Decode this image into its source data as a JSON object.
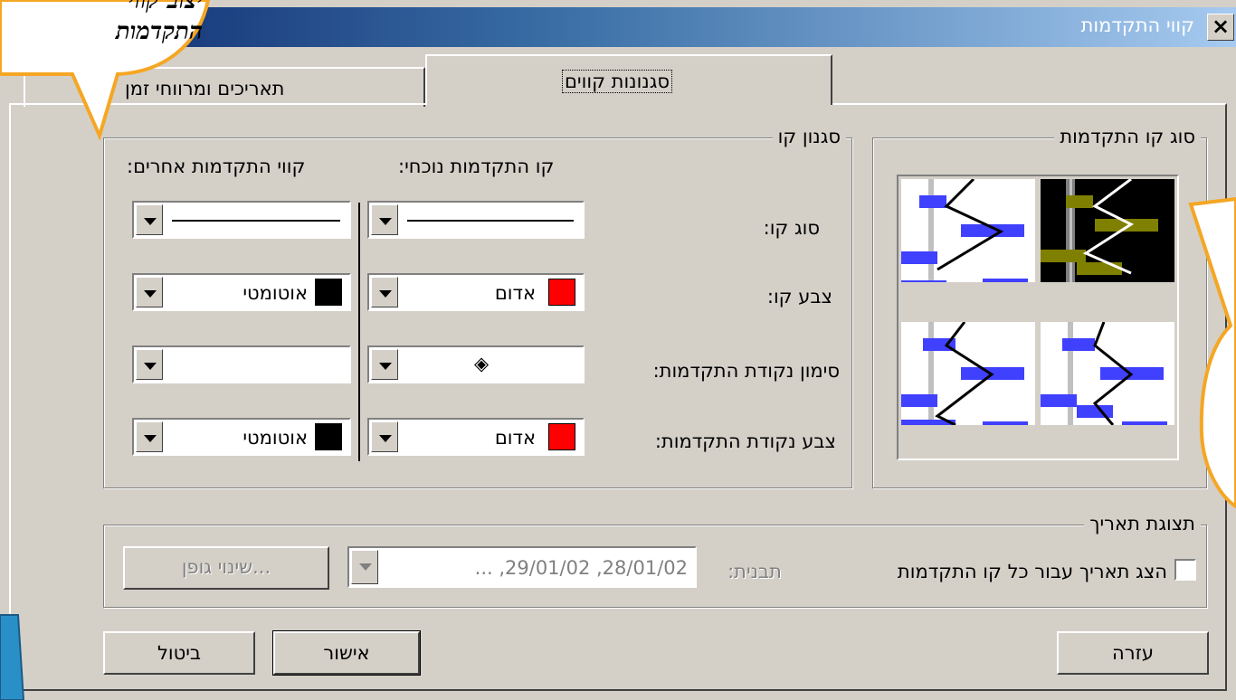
{
  "window": {
    "title": "קווי התקדמות"
  },
  "tabs": [
    {
      "label": "סגנונות קווים",
      "active": true
    },
    {
      "label": "תאריכים ומרווחי זמן",
      "active": false
    }
  ],
  "progress_type_group": {
    "title": "סוג קו התקדמות"
  },
  "line_style_group": {
    "title": "סגנון קו",
    "col_current": "קו התקדמות נוכחי:",
    "col_other": "קווי התקדמות אחרים:",
    "rows": {
      "line_type": "סוג קו:",
      "line_color": "צבע קו:",
      "point_marker": "סימון נקודת התקדמות:",
      "point_color": "צבע נקודת התקדמות:"
    },
    "current": {
      "line_color": {
        "text": "אדום",
        "swatch": "#ff0000"
      },
      "point_color": {
        "text": "אדום",
        "swatch": "#ff0000"
      },
      "point_marker_glyph": "◈"
    },
    "other": {
      "line_color": {
        "text": "אוטומטי",
        "swatch": "#000000"
      },
      "point_color": {
        "text": "אוטומטי",
        "swatch": "#000000"
      }
    }
  },
  "date_display_group": {
    "title": "תצוגת תאריך",
    "checkbox_label": "הצג תאריך עבור כל קו התקדמות",
    "checked": false,
    "format_label": "תבנית:",
    "format_value": "... ,29/01/02 ,28/01/02",
    "font_button": "שינוי גופן..."
  },
  "buttons": {
    "help": "עזרה",
    "ok": "אישור",
    "cancel": "ביטול"
  },
  "callout_text": [
    "יצוב קווי",
    "התקדמות"
  ],
  "colors": {
    "titlebar_start": "#0a246a",
    "titlebar_end": "#a6caf0",
    "face": "#d4d0c8",
    "callout": "#f5a623",
    "bar": "#4040ff"
  }
}
